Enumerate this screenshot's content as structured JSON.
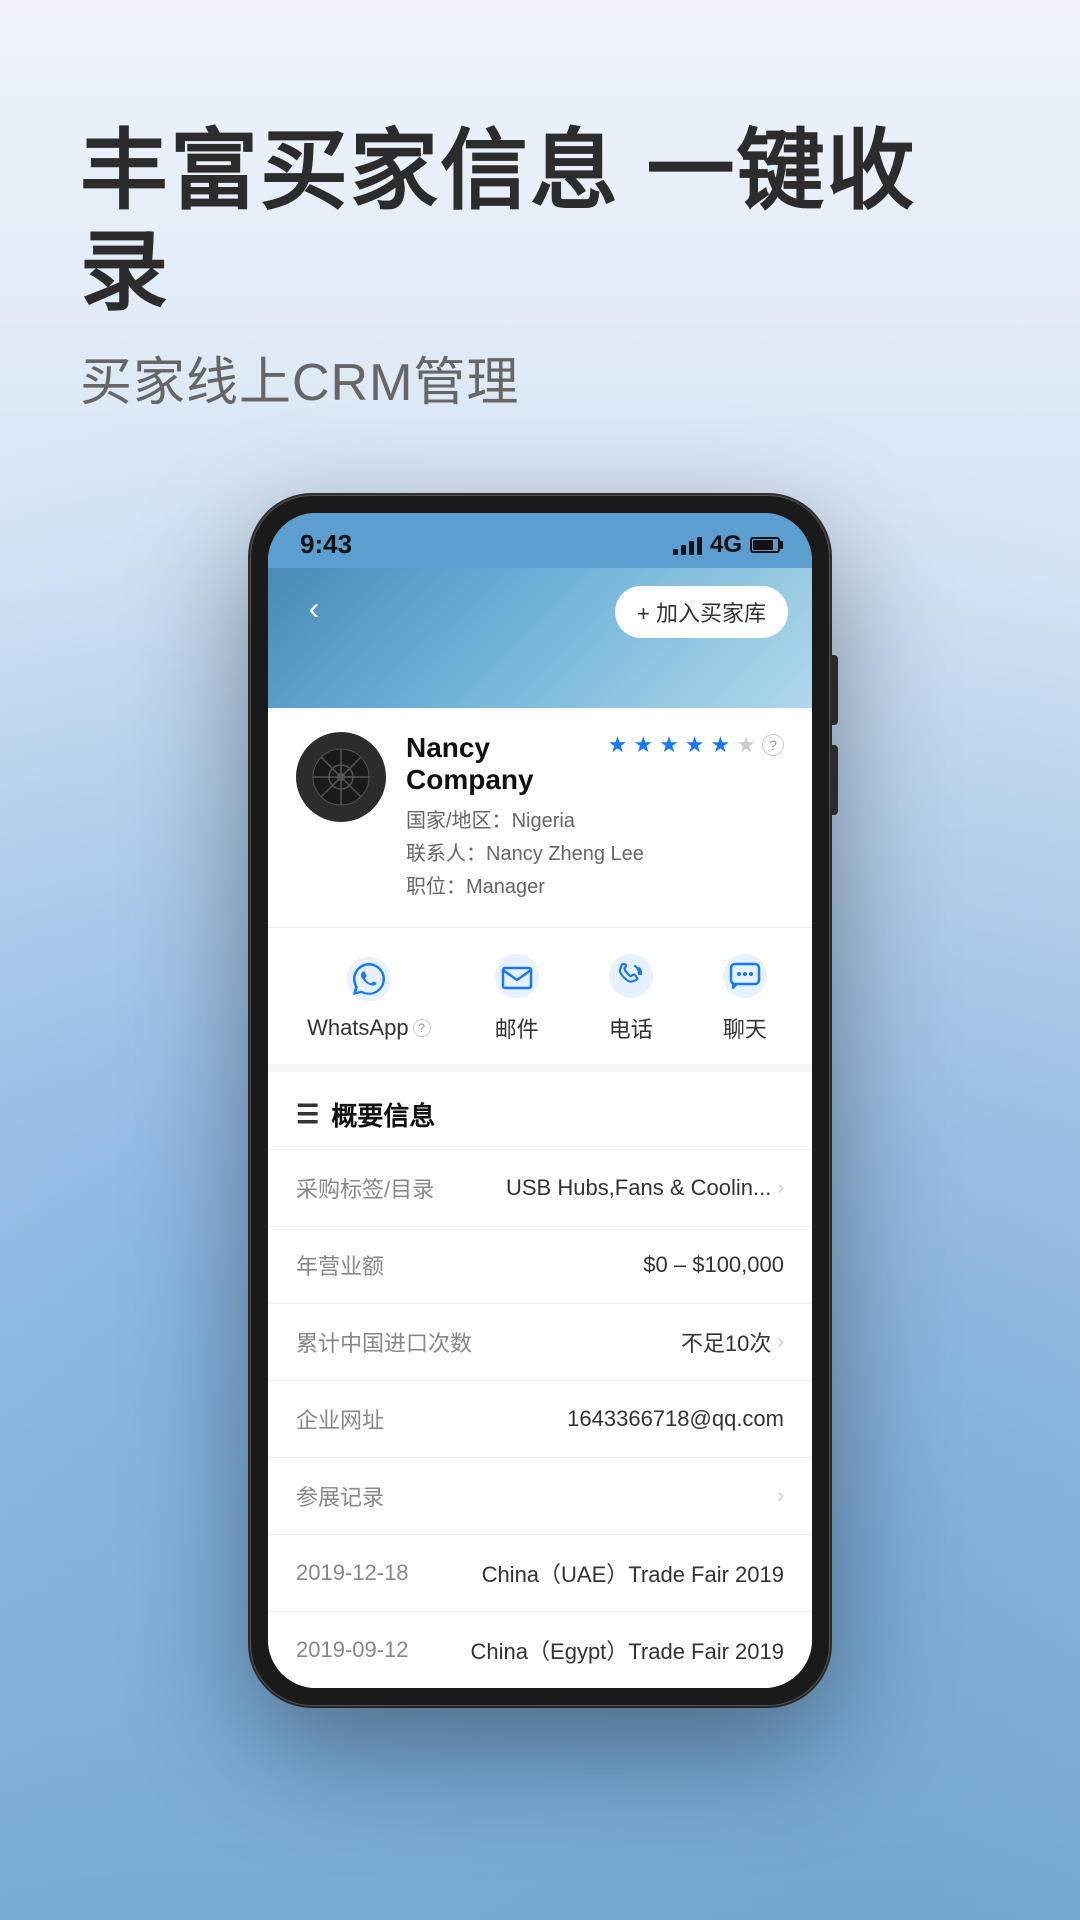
{
  "headline": {
    "main": "丰富买家信息 一键收录",
    "sub": "买家线上CRM管理"
  },
  "phone": {
    "status_bar": {
      "time": "9:43",
      "network": "4G"
    },
    "header": {
      "add_button": "+ 加入买家库"
    },
    "company": {
      "name": "Nancy Company",
      "country_label": "国家/地区：",
      "country": "Nigeria",
      "contact_label": "联系人：",
      "contact": "Nancy Zheng Lee",
      "title_label": "职位：",
      "title": "Manager",
      "stars": 5
    },
    "actions": {
      "whatsapp": "WhatsApp",
      "email": "邮件",
      "phone": "电话",
      "chat": "聊天"
    },
    "info_section": {
      "title": "概要信息",
      "rows": [
        {
          "label": "采购标签/目录",
          "value": "USB Hubs,Fans & Coolin...",
          "has_chevron": true
        },
        {
          "label": "年营业额",
          "value": "$0 – $100,000",
          "has_chevron": false
        },
        {
          "label": "累计中国进口次数",
          "value": "不足10次",
          "has_chevron": true
        },
        {
          "label": "企业网址",
          "value": "1643366718@qq.com",
          "has_chevron": false
        },
        {
          "label": "参展记录",
          "value": "",
          "has_chevron": true
        },
        {
          "label": "2019-12-18",
          "value": "China（UAE）Trade Fair 2019",
          "has_chevron": false
        },
        {
          "label": "2019-09-12",
          "value": "China（Egypt）Trade Fair 2019",
          "has_chevron": false
        }
      ]
    }
  }
}
